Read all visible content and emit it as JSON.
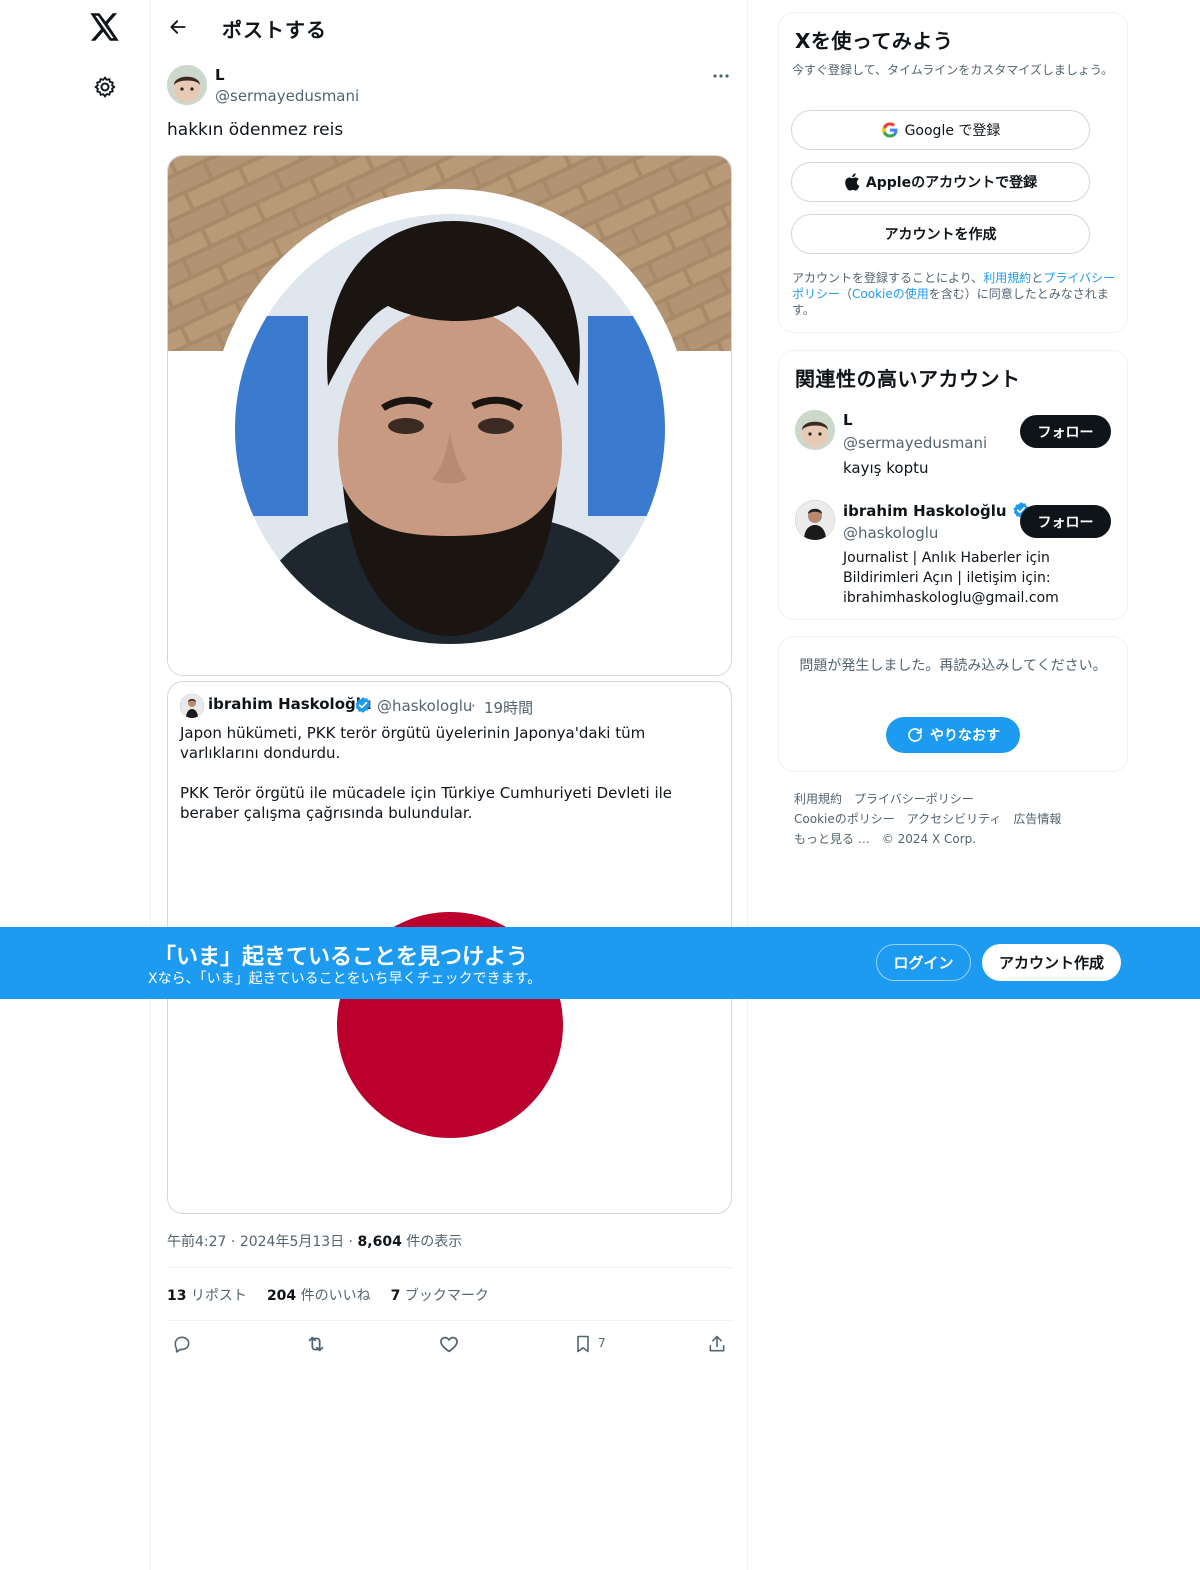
{
  "header": {
    "title": "ポストする"
  },
  "post": {
    "author_name": "L",
    "author_handle": "@sermayedusmani",
    "text": "hakkın ödenmez reis",
    "timestamp": "午前4:27",
    "date": "2024年5月13日",
    "views_count": "8,604",
    "views_label": " 件の表示",
    "reposts_count": "13",
    "reposts_label": " リポスト",
    "likes_count": "204",
    "likes_label": " 件のいいね",
    "bookmarks_count": "7",
    "bookmarks_label": " ブックマーク",
    "bookmark_action_count": "7"
  },
  "quote": {
    "author_name": "ibrahim Haskoloğlu",
    "author_handle": "@haskologlu",
    "separator": "·",
    "time": "19時間",
    "text_paragraph_1": "Japon hükümeti, PKK terör örgütü üyelerinin Japonya'daki tüm varlıklarını dondurdu.",
    "text_paragraph_2": "PKK Terör örgütü ile mücadele için Türkiye Cumhuriyeti Devleti ile beraber çalışma çağrısında bulundular."
  },
  "signup": {
    "title": "Xを使ってみよう",
    "subtitle": "今すぐ登録して、タイムラインをカスタマイズしましょう。",
    "google_label": "Google で登録",
    "apple_label": "Appleのアカウントで登録",
    "create_label": "アカウントを作成",
    "terms_prefix": "アカウントを登録することにより、",
    "terms_link": "利用規約",
    "terms_and": "と",
    "privacy_link": "プライバシーポリシー",
    "cookie_open": "（",
    "cookie_link": "Cookieの使用",
    "cookie_suffix": "を含む）に同意したとみなされます。"
  },
  "related": {
    "title": "関連性の高いアカウント",
    "accounts": [
      {
        "name": "L",
        "handle": "@sermayedusmani",
        "bio": "kayış koptu",
        "follow_label": "フォロー"
      },
      {
        "name": "ibrahim Haskoloğlu",
        "handle": "@haskologlu",
        "bio": "Journalist | Anlık Haberler için Bildirimleri Açın | iletişim için: ibrahimhaskologlu@gmail.com",
        "follow_label": "フォロー"
      }
    ]
  },
  "error": {
    "message": "問題が発生しました。再読み込みしてください。",
    "retry_label": "やりなおす"
  },
  "footer": {
    "links": [
      "利用規約",
      "プライバシーポリシー",
      "Cookieのポリシー",
      "アクセシビリティ",
      "広告情報",
      "もっと見る …"
    ],
    "copyright": "© 2024 X Corp."
  },
  "banner": {
    "title": "「いま」起きていることを見つけよう",
    "subtitle": "Xなら、「いま」起きていることをいち早くチェックできます。",
    "login_label": "ログイン",
    "signup_label": "アカウント作成"
  },
  "colors": {
    "accent": "#1d9bf0",
    "text": "#0f1419",
    "muted": "#536471",
    "japan_red": "#bc002d"
  },
  "icons": [
    "x-logo-icon",
    "gear-icon",
    "back-arrow-icon",
    "more-icon",
    "verified-icon",
    "reply-icon",
    "repost-icon",
    "like-icon",
    "bookmark-icon",
    "share-icon",
    "google-icon",
    "apple-icon",
    "refresh-icon"
  ]
}
